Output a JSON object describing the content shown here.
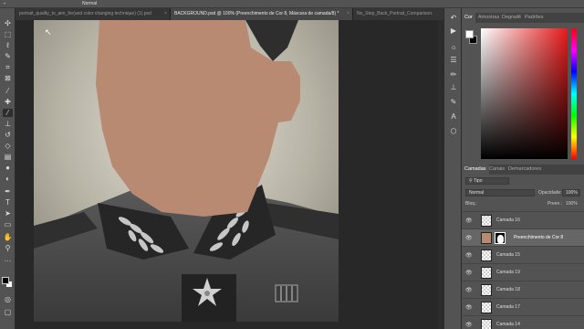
{
  "options_bar": {
    "mode_label": "Normal"
  },
  "tabs": [
    {
      "label": "portrait_quality_to_aim_for(and color changing technique) (1).psd",
      "active": false
    },
    {
      "label": "BACKGROUND.psd @ 100% (Preenchimento de Cor 8, Máscara de camada/8) *",
      "active": true
    },
    {
      "label": "No_Step_Back_Portrait_Comparison.",
      "active": false
    }
  ],
  "color_panel": {
    "tabs": [
      "Cor",
      "Amostras",
      "Degradê",
      "Padrões"
    ],
    "fg_color": "#ffffff",
    "bg_color": "#000000",
    "hue_color": "#e81a1a"
  },
  "layers_panel": {
    "tabs": [
      "Camadas",
      "Canais",
      "Demarcadores"
    ],
    "filter_label": "Tipo",
    "blend_mode": "Normal",
    "opacity_label": "Opacidade:",
    "opacity_value": "100%",
    "lock_label": "Bloq.:",
    "fill_label": "Preen.:",
    "fill_value": "100%",
    "layers": [
      {
        "name": "Camada 16",
        "selected": false,
        "type": "transparent"
      },
      {
        "name": "Preenchimento de Cor 8",
        "selected": true,
        "type": "fill"
      },
      {
        "name": "Camada 15",
        "selected": false,
        "type": "transparent"
      },
      {
        "name": "Camada 19",
        "selected": false,
        "type": "transparent"
      },
      {
        "name": "Camada 18",
        "selected": false,
        "type": "transparent"
      },
      {
        "name": "Camada 17",
        "selected": false,
        "type": "transparent"
      },
      {
        "name": "Camada 14",
        "selected": false,
        "type": "transparent"
      }
    ]
  },
  "colors": {
    "skin_fill": "#b88a71",
    "ui_dark": "#282828",
    "ui_panel": "#535353"
  }
}
